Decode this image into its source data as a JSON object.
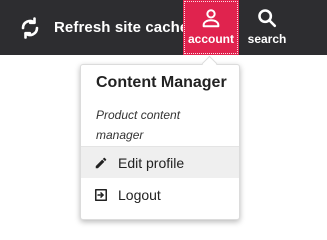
{
  "header": {
    "refresh": {
      "label": "Refresh site cache",
      "icon": "refresh-icon"
    },
    "nav": {
      "account": {
        "label": "account",
        "icon": "user-icon"
      },
      "search": {
        "label": "search",
        "icon": "search-icon"
      }
    }
  },
  "account_menu": {
    "name": "Content Manager",
    "role": "Product content manager",
    "items": [
      {
        "label": "Edit profile",
        "icon": "pencil-icon"
      },
      {
        "label": "Logout",
        "icon": "logout-icon"
      }
    ]
  },
  "colors": {
    "header_bg": "#2d2d30",
    "accent": "#e0234e",
    "menu_hover": "#efefef"
  }
}
